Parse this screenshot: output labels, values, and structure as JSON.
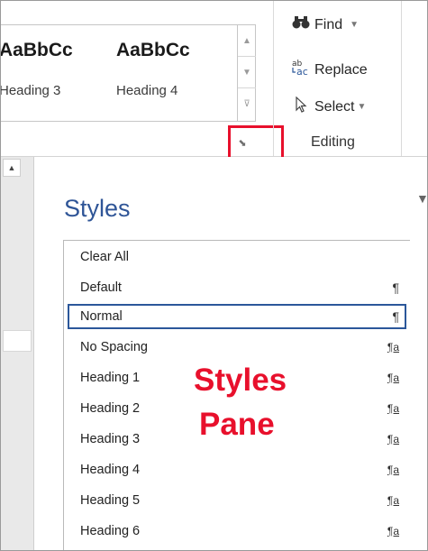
{
  "ribbon": {
    "styles_gallery": [
      {
        "sample": "AaBbCc",
        "caption": "Heading 3"
      },
      {
        "sample": "AaBbCc",
        "caption": "Heading 4"
      }
    ],
    "gallery_scroll": {
      "up_icon": "caret-up-icon",
      "down_icon": "caret-down-icon",
      "more_icon": "more-styles-icon"
    },
    "dialog_launcher_icon": "dialog-launcher-icon",
    "editing_group": {
      "label": "Editing",
      "find": {
        "label": "Find",
        "icon": "binoculars-icon"
      },
      "replace": {
        "label": "Replace",
        "icon": "replace-ab-ac-icon",
        "icon_text": "ab→ac"
      },
      "select": {
        "label": "Select",
        "icon": "pointer-icon"
      }
    },
    "highlight_color": "#e8102c"
  },
  "pane": {
    "title": "Styles",
    "title_color": "#2f5597",
    "styles": [
      {
        "name": "Clear All",
        "mark": ""
      },
      {
        "name": "Default",
        "mark": "¶"
      },
      {
        "name": "Normal",
        "mark": "¶",
        "selected": true
      },
      {
        "name": "No Spacing",
        "mark": "¶a"
      },
      {
        "name": "Heading 1",
        "mark": "¶a"
      },
      {
        "name": "Heading 2",
        "mark": "¶a"
      },
      {
        "name": "Heading 3",
        "mark": "¶a"
      },
      {
        "name": "Heading 4",
        "mark": "¶a"
      },
      {
        "name": "Heading 5",
        "mark": "¶a"
      },
      {
        "name": "Heading 6",
        "mark": "¶a"
      }
    ]
  },
  "annotation": {
    "line1": "Styles",
    "line2": "Pane"
  }
}
